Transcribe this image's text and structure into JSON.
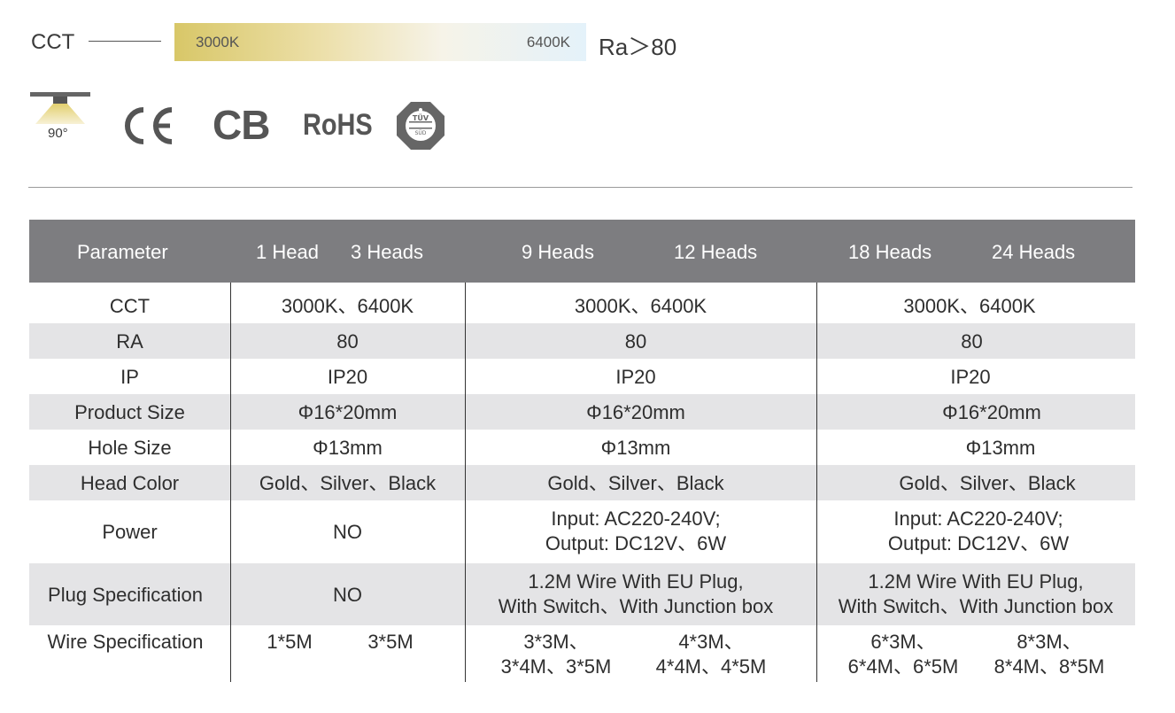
{
  "cct": {
    "label": "CCT",
    "min": "3000K",
    "max": "6400K",
    "ra": "Ra＞80"
  },
  "icons": {
    "beam_angle": "90°",
    "ce": "CE",
    "cb": "CB",
    "rohs": "RoHS",
    "tuv_text": "TÜV",
    "tuv_sub": "SÜD"
  },
  "table": {
    "header": {
      "parameter": "Parameter",
      "h1": "1 Head",
      "h3": "3 Heads",
      "h9": "9 Heads",
      "h12": "12 Heads",
      "h18": "18 Heads",
      "h24": "24 Heads"
    },
    "rows": {
      "cct": {
        "label": "CCT",
        "g1": "3000K、6400K",
        "g2": "3000K、6400K",
        "g3": "3000K、6400K"
      },
      "ra": {
        "label": "RA",
        "g1": "80",
        "g2": "80",
        "g3": "80"
      },
      "ip": {
        "label": "IP",
        "g1": "IP20",
        "g2": "IP20",
        "g3": "IP20"
      },
      "product_size": {
        "label": "Product Size",
        "g1": "Φ16*20mm",
        "g2": "Φ16*20mm",
        "g3": "Φ16*20mm"
      },
      "hole_size": {
        "label": "Hole Size",
        "g1": "Φ13mm",
        "g2": "Φ13mm",
        "g3": "Φ13mm"
      },
      "head_color": {
        "label": "Head Color",
        "g1": "Gold、Silver、Black",
        "g2": "Gold、Silver、Black",
        "g3": "Gold、Silver、Black"
      },
      "power": {
        "label": "Power",
        "g1": "NO",
        "g2_l1": "Input: AC220-240V;",
        "g2_l2": "Output: DC12V、6W",
        "g3_l1": "Input: AC220-240V;",
        "g3_l2": "Output: DC12V、6W"
      },
      "plug": {
        "label": "Plug Specification",
        "g1": "NO",
        "g2_l1": "1.2M Wire With EU Plug,",
        "g2_l2": "With Switch、With Junction box",
        "g3_l1": "1.2M Wire With EU Plug,",
        "g3_l2": "With Switch、With Junction box"
      },
      "wire": {
        "label": "Wire Specification",
        "h1": "1*5M",
        "h3": "3*5M",
        "h9_l1": "3*3M、",
        "h9_l2": "3*4M、3*5M",
        "h12_l1": "4*3M、",
        "h12_l2": "4*4M、4*5M",
        "h18_l1": "6*3M、",
        "h18_l2": "6*4M、6*5M",
        "h24_l1": "8*3M、",
        "h24_l2": "8*4M、8*5M"
      }
    }
  }
}
